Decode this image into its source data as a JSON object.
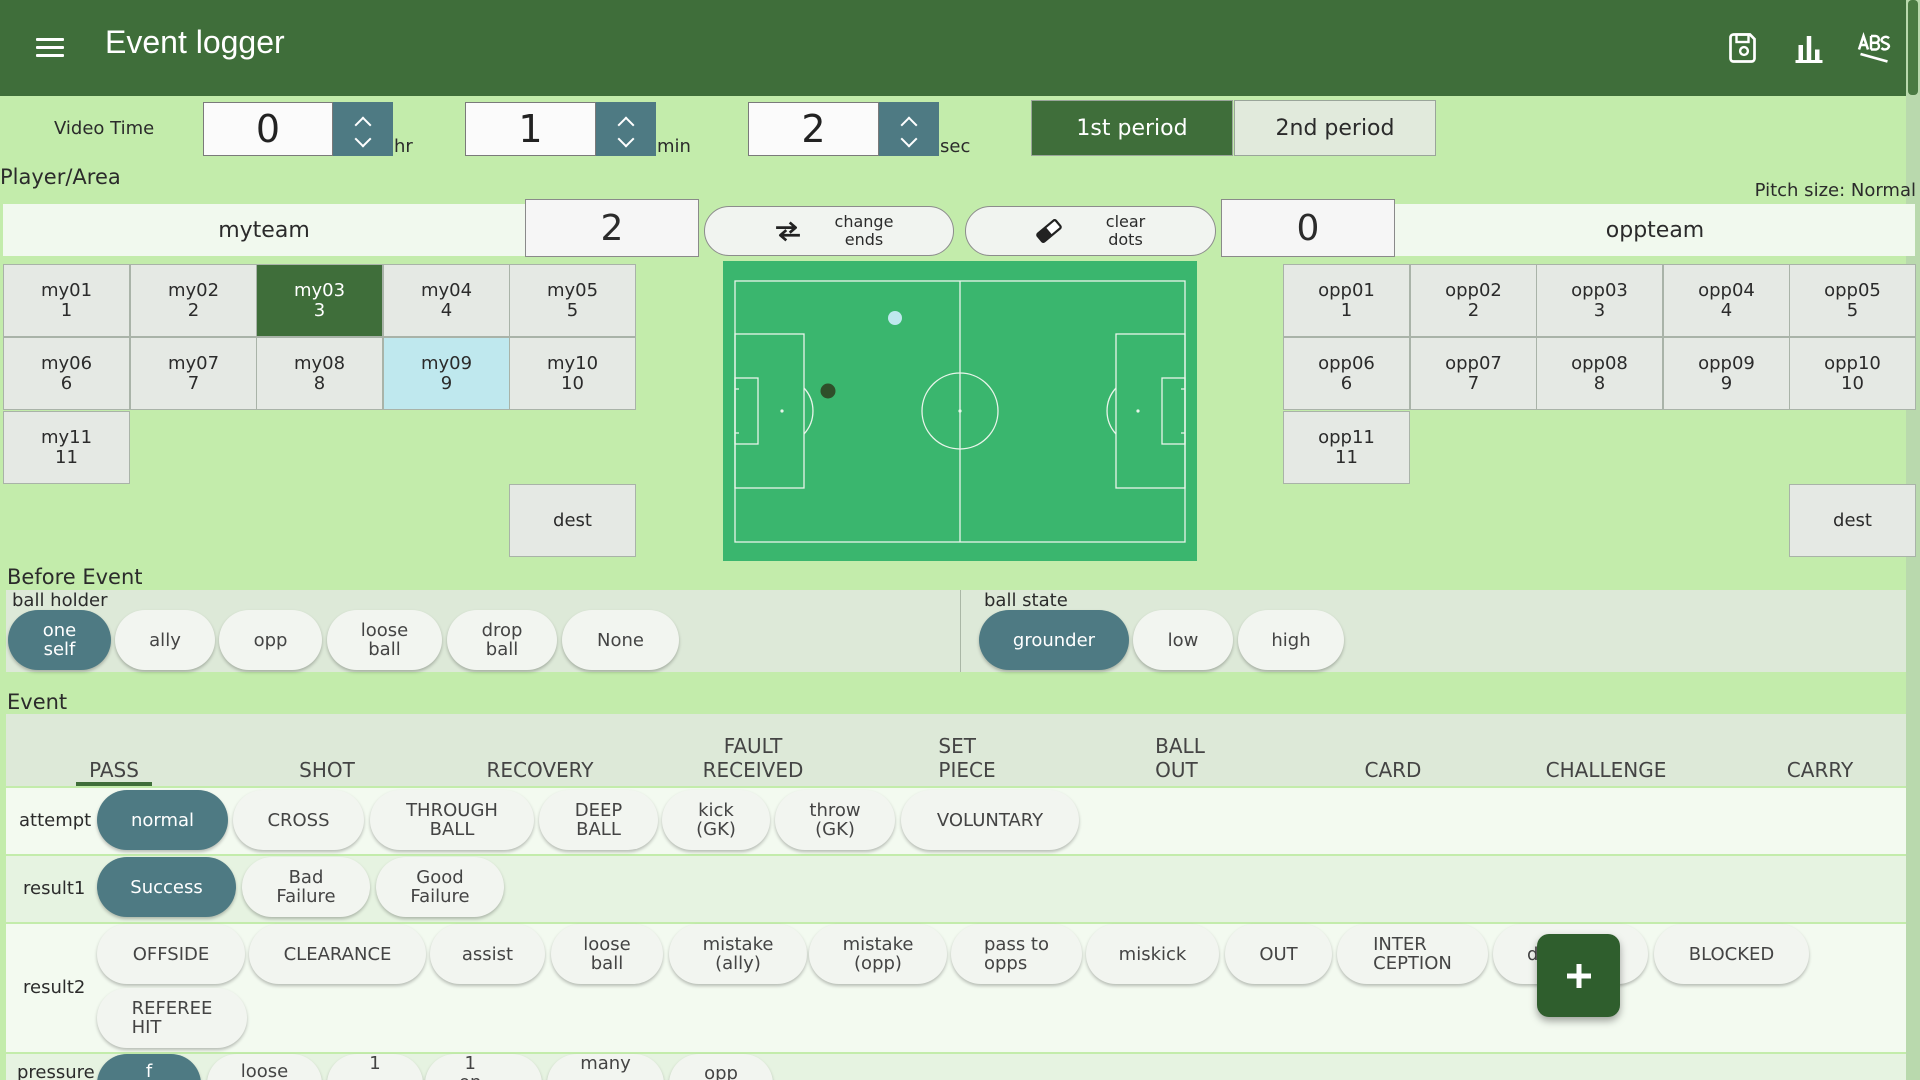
{
  "app": {
    "title": "Event logger"
  },
  "video_time": {
    "label": "Video Time",
    "hr": {
      "value": "0",
      "unit": "hr"
    },
    "min": {
      "value": "1",
      "unit": "min"
    },
    "sec": {
      "value": "2",
      "unit": "sec"
    }
  },
  "periods": {
    "first": "1st period",
    "second": "2nd period",
    "selected": "1st period"
  },
  "player_area": {
    "label": "Player/Area",
    "pitch_size": "Pitch size: Normal"
  },
  "my_team": {
    "name": "myteam",
    "score": "2",
    "selected_player": "my03",
    "highlighted_player": "my09",
    "players": [
      {
        "name": "my01",
        "number": "1"
      },
      {
        "name": "my02",
        "number": "2"
      },
      {
        "name": "my03",
        "number": "3"
      },
      {
        "name": "my04",
        "number": "4"
      },
      {
        "name": "my05",
        "number": "5"
      },
      {
        "name": "my06",
        "number": "6"
      },
      {
        "name": "my07",
        "number": "7"
      },
      {
        "name": "my08",
        "number": "8"
      },
      {
        "name": "my09",
        "number": "9"
      },
      {
        "name": "my10",
        "number": "10"
      },
      {
        "name": "my11",
        "number": "11"
      }
    ],
    "dest": "dest"
  },
  "opp_team": {
    "name": "oppteam",
    "score": "0",
    "players": [
      {
        "name": "opp01",
        "number": "1"
      },
      {
        "name": "opp02",
        "number": "2"
      },
      {
        "name": "opp03",
        "number": "3"
      },
      {
        "name": "opp04",
        "number": "4"
      },
      {
        "name": "opp05",
        "number": "5"
      },
      {
        "name": "opp06",
        "number": "6"
      },
      {
        "name": "opp07",
        "number": "7"
      },
      {
        "name": "opp08",
        "number": "8"
      },
      {
        "name": "opp09",
        "number": "9"
      },
      {
        "name": "opp10",
        "number": "10"
      },
      {
        "name": "opp11",
        "number": "11"
      }
    ],
    "dest": "dest"
  },
  "tools": {
    "change_ends": {
      "line1": "change",
      "line2": "ends"
    },
    "clear_dots": {
      "line1": "clear",
      "line2": "dots"
    }
  },
  "before_event": {
    "heading": "Before Event",
    "ball_holder": {
      "label": "ball holder",
      "options": [
        [
          "one",
          "self"
        ],
        [
          "ally"
        ],
        [
          "opp"
        ],
        [
          "loose",
          "ball"
        ],
        [
          "drop",
          "ball"
        ],
        [
          "None"
        ]
      ],
      "selected": "one self"
    },
    "ball_state": {
      "label": "ball state",
      "options": [
        [
          "grounder"
        ],
        [
          "low"
        ],
        [
          "high"
        ]
      ],
      "selected": "grounder"
    }
  },
  "event": {
    "heading": "Event",
    "tabs": [
      [
        "PASS"
      ],
      [
        "SHOT"
      ],
      [
        "RECOVERY"
      ],
      [
        "FAULT",
        "RECEIVED"
      ],
      [
        "SET",
        "PIECE"
      ],
      [
        "BALL",
        "OUT"
      ],
      [
        "CARD"
      ],
      [
        "CHALLENGE"
      ],
      [
        "CARRY"
      ]
    ],
    "selected_tab": "PASS",
    "attempt": {
      "label": "attempt",
      "options": [
        [
          "normal"
        ],
        [
          "CROSS"
        ],
        [
          "THROUGH",
          "BALL"
        ],
        [
          "DEEP",
          "BALL"
        ],
        [
          "kick",
          "(GK)"
        ],
        [
          "throw",
          "(GK)"
        ],
        [
          "VOLUNTARY"
        ]
      ],
      "selected": "normal"
    },
    "result1": {
      "label": "result1",
      "options": [
        [
          "Success"
        ],
        [
          "Bad",
          "Failure"
        ],
        [
          "Good",
          "Failure"
        ]
      ],
      "selected": "Success"
    },
    "result2": {
      "label": "result2",
      "options": [
        [
          "OFFSIDE"
        ],
        [
          "CLEARANCE"
        ],
        [
          "assist"
        ],
        [
          "loose",
          "ball"
        ],
        [
          "mistake",
          "(ally)"
        ],
        [
          "mistake",
          "(opp)"
        ],
        [
          "pass to",
          "opps"
        ],
        [
          "miskick"
        ],
        [
          "OUT"
        ],
        [
          "INTER",
          "CEPTION"
        ],
        [
          "d"
        ],
        [
          "BLOCKED"
        ],
        [
          "REFEREE",
          "HIT"
        ]
      ]
    },
    "pressure": {
      "label": "pressure",
      "options": [
        [
          "f"
        ],
        [
          "loose"
        ],
        [
          "1"
        ],
        [
          "1",
          "on"
        ],
        [
          "many"
        ],
        [
          "opp"
        ]
      ]
    }
  },
  "pitch": {
    "dots": [
      {
        "kind": "ball",
        "color": "#bfe8ee"
      },
      {
        "kind": "player",
        "color": "#2f4f2a"
      }
    ]
  },
  "colors": {
    "primary": "#3f6e3a",
    "chip_selected": "#4e7a83",
    "background": "#c3ecab",
    "pitch": "#3ab66e"
  }
}
